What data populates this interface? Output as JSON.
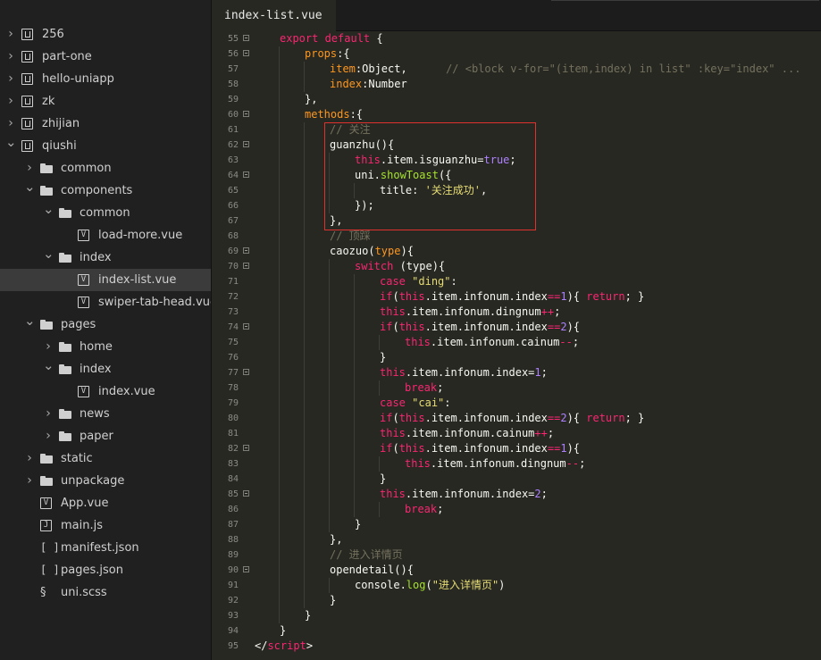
{
  "sidebar": {
    "items": [
      {
        "label": "256",
        "type": "project",
        "level": 0,
        "expanded": false,
        "selected": false
      },
      {
        "label": "part-one",
        "type": "project",
        "level": 0,
        "expanded": false,
        "selected": false
      },
      {
        "label": "hello-uniapp",
        "type": "project",
        "level": 0,
        "expanded": false,
        "selected": false
      },
      {
        "label": "zk",
        "type": "project",
        "level": 0,
        "expanded": false,
        "selected": false
      },
      {
        "label": "zhijian",
        "type": "project",
        "level": 0,
        "expanded": false,
        "selected": false
      },
      {
        "label": "qiushi",
        "type": "project",
        "level": 0,
        "expanded": true,
        "selected": false
      },
      {
        "label": "common",
        "type": "folder",
        "level": 1,
        "expanded": false,
        "selected": false
      },
      {
        "label": "components",
        "type": "folder",
        "level": 1,
        "expanded": true,
        "selected": false
      },
      {
        "label": "common",
        "type": "folder",
        "level": 2,
        "expanded": true,
        "selected": false
      },
      {
        "label": "load-more.vue",
        "type": "vue",
        "level": 3,
        "selected": false
      },
      {
        "label": "index",
        "type": "folder",
        "level": 2,
        "expanded": true,
        "selected": false
      },
      {
        "label": "index-list.vue",
        "type": "vue",
        "level": 3,
        "selected": true
      },
      {
        "label": "swiper-tab-head.vue",
        "type": "vue",
        "level": 3,
        "selected": false
      },
      {
        "label": "pages",
        "type": "folder",
        "level": 1,
        "expanded": true,
        "selected": false
      },
      {
        "label": "home",
        "type": "folder",
        "level": 2,
        "expanded": false,
        "selected": false
      },
      {
        "label": "index",
        "type": "folder",
        "level": 2,
        "expanded": true,
        "selected": false
      },
      {
        "label": "index.vue",
        "type": "vue",
        "level": 3,
        "selected": false
      },
      {
        "label": "news",
        "type": "folder",
        "level": 2,
        "expanded": false,
        "selected": false
      },
      {
        "label": "paper",
        "type": "folder",
        "level": 2,
        "expanded": false,
        "selected": false
      },
      {
        "label": "static",
        "type": "folder",
        "level": 1,
        "expanded": false,
        "selected": false
      },
      {
        "label": "unpackage",
        "type": "folder",
        "level": 1,
        "expanded": false,
        "selected": false
      },
      {
        "label": "App.vue",
        "type": "vue",
        "level": 1,
        "selected": false
      },
      {
        "label": "main.js",
        "type": "js",
        "level": 1,
        "selected": false
      },
      {
        "label": "manifest.json",
        "type": "json",
        "level": 1,
        "selected": false
      },
      {
        "label": "pages.json",
        "type": "json",
        "level": 1,
        "selected": false
      },
      {
        "label": "uni.scss",
        "type": "css",
        "level": 1,
        "selected": false
      }
    ]
  },
  "tabs": {
    "active": "index-list.vue"
  },
  "editor": {
    "lines": [
      {
        "n": "55",
        "fold": true,
        "indent": 1,
        "tokens": [
          [
            "kw",
            "export default"
          ],
          [
            "pl",
            " {"
          ]
        ]
      },
      {
        "n": "56",
        "fold": true,
        "indent": 2,
        "tokens": [
          [
            "var",
            "props"
          ],
          [
            "pl",
            ":{"
          ]
        ]
      },
      {
        "n": "57",
        "fold": false,
        "indent": 3,
        "tokens": [
          [
            "var",
            "item"
          ],
          [
            "pl",
            ":Object,"
          ],
          [
            "pl",
            "      "
          ],
          [
            "com",
            "// <block v-for=\"(item,index) in list\" :key=\"index\" ..."
          ]
        ]
      },
      {
        "n": "58",
        "fold": false,
        "indent": 3,
        "tokens": [
          [
            "var",
            "index"
          ],
          [
            "pl",
            ":Number"
          ]
        ]
      },
      {
        "n": "59",
        "fold": false,
        "indent": 2,
        "tokens": [
          [
            "pl",
            "},"
          ]
        ]
      },
      {
        "n": "60",
        "fold": true,
        "indent": 2,
        "tokens": [
          [
            "var",
            "methods"
          ],
          [
            "pl",
            ":{"
          ]
        ]
      },
      {
        "n": "61",
        "fold": false,
        "indent": 3,
        "tokens": [
          [
            "com",
            "// 关注"
          ]
        ]
      },
      {
        "n": "62",
        "fold": true,
        "indent": 3,
        "tokens": [
          [
            "pl",
            "guanzhu(){"
          ]
        ]
      },
      {
        "n": "63",
        "fold": false,
        "indent": 4,
        "tokens": [
          [
            "this",
            "this"
          ],
          [
            "pl",
            ".item.isguanzhu="
          ],
          [
            "num",
            "true"
          ],
          [
            "pl",
            ";"
          ]
        ]
      },
      {
        "n": "64",
        "fold": true,
        "indent": 4,
        "tokens": [
          [
            "pl",
            "uni."
          ],
          [
            "fn",
            "showToast"
          ],
          [
            "pl",
            "({"
          ]
        ]
      },
      {
        "n": "65",
        "fold": false,
        "indent": 5,
        "tokens": [
          [
            "pl",
            "title: "
          ],
          [
            "str",
            "'关注成功'"
          ],
          [
            "pl",
            ","
          ]
        ]
      },
      {
        "n": "66",
        "fold": false,
        "indent": 4,
        "tokens": [
          [
            "pl",
            "});"
          ]
        ]
      },
      {
        "n": "67",
        "fold": false,
        "indent": 3,
        "tokens": [
          [
            "pl",
            "},"
          ]
        ]
      },
      {
        "n": "68",
        "fold": false,
        "indent": 3,
        "tokens": [
          [
            "com",
            "// 顶踩"
          ]
        ]
      },
      {
        "n": "69",
        "fold": true,
        "indent": 3,
        "tokens": [
          [
            "pl",
            "caozuo("
          ],
          [
            "var",
            "type"
          ],
          [
            "pl",
            "){"
          ]
        ]
      },
      {
        "n": "70",
        "fold": true,
        "indent": 4,
        "tokens": [
          [
            "kw",
            "switch"
          ],
          [
            "pl",
            " (type){"
          ]
        ]
      },
      {
        "n": "71",
        "fold": false,
        "indent": 5,
        "tokens": [
          [
            "kw",
            "case"
          ],
          [
            "pl",
            " "
          ],
          [
            "str",
            "\"ding\""
          ],
          [
            "pl",
            ":"
          ]
        ]
      },
      {
        "n": "72",
        "fold": false,
        "indent": 5,
        "tokens": [
          [
            "kw",
            "if"
          ],
          [
            "pl",
            "("
          ],
          [
            "this",
            "this"
          ],
          [
            "pl",
            ".item.infonum.index"
          ],
          [
            "kw",
            "=="
          ],
          [
            "num",
            "1"
          ],
          [
            "pl",
            "){ "
          ],
          [
            "kw",
            "return"
          ],
          [
            "pl",
            "; }"
          ]
        ]
      },
      {
        "n": "73",
        "fold": false,
        "indent": 5,
        "tokens": [
          [
            "this",
            "this"
          ],
          [
            "pl",
            ".item.infonum.dingnum"
          ],
          [
            "kw",
            "++"
          ],
          [
            "pl",
            ";"
          ]
        ]
      },
      {
        "n": "74",
        "fold": true,
        "indent": 5,
        "tokens": [
          [
            "kw",
            "if"
          ],
          [
            "pl",
            "("
          ],
          [
            "this",
            "this"
          ],
          [
            "pl",
            ".item.infonum.index"
          ],
          [
            "kw",
            "=="
          ],
          [
            "num",
            "2"
          ],
          [
            "pl",
            "){"
          ]
        ]
      },
      {
        "n": "75",
        "fold": false,
        "indent": 6,
        "tokens": [
          [
            "this",
            "this"
          ],
          [
            "pl",
            ".item.infonum.cainum"
          ],
          [
            "kw",
            "--"
          ],
          [
            "pl",
            ";"
          ]
        ]
      },
      {
        "n": "76",
        "fold": false,
        "indent": 5,
        "tokens": [
          [
            "pl",
            "}"
          ]
        ]
      },
      {
        "n": "77",
        "fold": true,
        "indent": 5,
        "tokens": [
          [
            "this",
            "this"
          ],
          [
            "pl",
            ".item.infonum.index="
          ],
          [
            "num",
            "1"
          ],
          [
            "pl",
            ";"
          ]
        ]
      },
      {
        "n": "78",
        "fold": false,
        "indent": 6,
        "tokens": [
          [
            "kw",
            "break"
          ],
          [
            "pl",
            ";"
          ]
        ]
      },
      {
        "n": "79",
        "fold": false,
        "indent": 5,
        "tokens": [
          [
            "kw",
            "case"
          ],
          [
            "pl",
            " "
          ],
          [
            "str",
            "\"cai\""
          ],
          [
            "pl",
            ":"
          ]
        ]
      },
      {
        "n": "80",
        "fold": false,
        "indent": 5,
        "tokens": [
          [
            "kw",
            "if"
          ],
          [
            "pl",
            "("
          ],
          [
            "this",
            "this"
          ],
          [
            "pl",
            ".item.infonum.index"
          ],
          [
            "kw",
            "=="
          ],
          [
            "num",
            "2"
          ],
          [
            "pl",
            "){ "
          ],
          [
            "kw",
            "return"
          ],
          [
            "pl",
            "; }"
          ]
        ]
      },
      {
        "n": "81",
        "fold": false,
        "indent": 5,
        "tokens": [
          [
            "this",
            "this"
          ],
          [
            "pl",
            ".item.infonum.cainum"
          ],
          [
            "kw",
            "++"
          ],
          [
            "pl",
            ";"
          ]
        ]
      },
      {
        "n": "82",
        "fold": true,
        "indent": 5,
        "tokens": [
          [
            "kw",
            "if"
          ],
          [
            "pl",
            "("
          ],
          [
            "this",
            "this"
          ],
          [
            "pl",
            ".item.infonum.index"
          ],
          [
            "kw",
            "=="
          ],
          [
            "num",
            "1"
          ],
          [
            "pl",
            "){"
          ]
        ]
      },
      {
        "n": "83",
        "fold": false,
        "indent": 6,
        "tokens": [
          [
            "this",
            "this"
          ],
          [
            "pl",
            ".item.infonum.dingnum"
          ],
          [
            "kw",
            "--"
          ],
          [
            "pl",
            ";"
          ]
        ]
      },
      {
        "n": "84",
        "fold": false,
        "indent": 5,
        "tokens": [
          [
            "pl",
            "}"
          ]
        ]
      },
      {
        "n": "85",
        "fold": true,
        "indent": 5,
        "tokens": [
          [
            "this",
            "this"
          ],
          [
            "pl",
            ".item.infonum.index="
          ],
          [
            "num",
            "2"
          ],
          [
            "pl",
            ";"
          ]
        ]
      },
      {
        "n": "86",
        "fold": false,
        "indent": 6,
        "tokens": [
          [
            "kw",
            "break"
          ],
          [
            "pl",
            ";"
          ]
        ]
      },
      {
        "n": "87",
        "fold": false,
        "indent": 4,
        "tokens": [
          [
            "pl",
            "}"
          ]
        ]
      },
      {
        "n": "88",
        "fold": false,
        "indent": 3,
        "tokens": [
          [
            "pl",
            "},"
          ]
        ]
      },
      {
        "n": "89",
        "fold": false,
        "indent": 3,
        "tokens": [
          [
            "com",
            "// 进入详情页"
          ]
        ]
      },
      {
        "n": "90",
        "fold": true,
        "indent": 3,
        "tokens": [
          [
            "pl",
            "opendetail(){"
          ]
        ]
      },
      {
        "n": "91",
        "fold": false,
        "indent": 4,
        "tokens": [
          [
            "pl",
            "console."
          ],
          [
            "fn",
            "log"
          ],
          [
            "pl",
            "("
          ],
          [
            "str",
            "\"进入详情页\""
          ],
          [
            "pl",
            ")"
          ]
        ]
      },
      {
        "n": "92",
        "fold": false,
        "indent": 3,
        "tokens": [
          [
            "pl",
            "}"
          ]
        ]
      },
      {
        "n": "93",
        "fold": false,
        "indent": 2,
        "tokens": [
          [
            "pl",
            "}"
          ]
        ]
      },
      {
        "n": "94",
        "fold": false,
        "indent": 1,
        "tokens": [
          [
            "pl",
            "}"
          ]
        ]
      },
      {
        "n": "95",
        "fold": false,
        "indent": 0,
        "tokens": [
          [
            "pl",
            "</"
          ],
          [
            "tag",
            "script"
          ],
          [
            "pl",
            ">"
          ]
        ]
      }
    ]
  },
  "colors": {
    "editor_bg": "#272822",
    "sidebar_bg": "#202020",
    "highlight_box": "#e0312e",
    "keyword": "#f92672",
    "string": "#e6db74",
    "comment": "#75715e",
    "number": "#ae81ff",
    "variable": "#fd971f",
    "function": "#a6e22e"
  },
  "icons": {
    "project": "project-icon",
    "folder": "folder-icon",
    "vue": "vue-file-icon",
    "js": "js-file-icon",
    "json": "json-file-icon",
    "css": "scss-file-icon",
    "expand": "chevron-down-icon",
    "collapse": "chevron-right-icon",
    "fold": "fold-toggle-icon"
  }
}
